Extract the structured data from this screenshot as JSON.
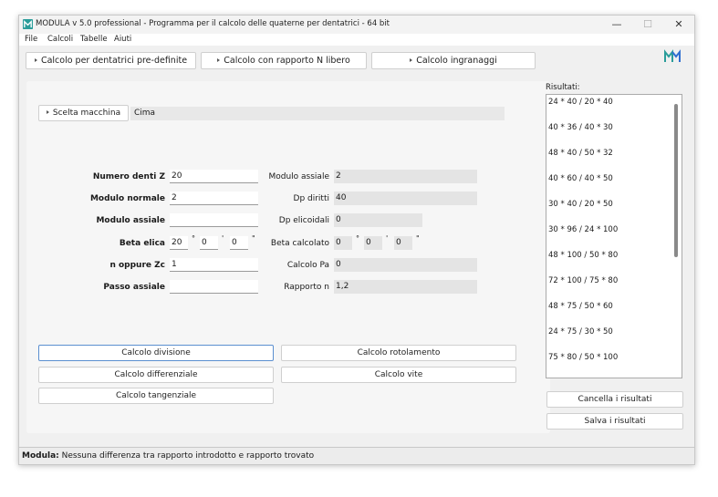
{
  "window": {
    "title": "MODULA v 5.0 professional - Programma per il calcolo delle quaterne per dentatrici - 64 bit",
    "controls": {
      "minimize": "—",
      "maximize": "☐",
      "close": "✕"
    }
  },
  "menu": {
    "items": [
      "File",
      "Calcoli",
      "Tabelle",
      "Aiuti"
    ]
  },
  "top_buttons": {
    "predefined": "Calcolo per dentatrici pre-definite",
    "ratio_free": "Calcolo con rapporto N libero",
    "gears": "Calcolo ingranaggi"
  },
  "machine": {
    "button_label": "Scelta macchina",
    "value": "Cima"
  },
  "left_fields": {
    "numero_denti_z": {
      "label": "Numero denti Z",
      "value": "20"
    },
    "modulo_normale": {
      "label": "Modulo normale",
      "value": "2"
    },
    "modulo_assiale": {
      "label": "Modulo assiale",
      "value": ""
    },
    "beta_elica": {
      "label": "Beta elica",
      "deg": "20",
      "min": "0",
      "sec": "0"
    },
    "n_oppure_zc": {
      "label": "n oppure Zc",
      "value": "1"
    },
    "passo_assiale": {
      "label": "Passo assiale",
      "value": ""
    }
  },
  "right_fields": {
    "modulo_assiale": {
      "label": "Modulo assiale",
      "value": "2"
    },
    "dp_diritti": {
      "label": "Dp diritti",
      "value": "40"
    },
    "dp_elicoidali": {
      "label": "Dp elicoidali",
      "value": "0"
    },
    "beta_calcolato": {
      "label": "Beta calcolato",
      "deg": "0",
      "min": "0",
      "sec": "0"
    },
    "calcolo_pa": {
      "label": "Calcolo Pa",
      "value": "0"
    },
    "rapporto_n": {
      "label": "Rapporto n",
      "value": "1,2"
    }
  },
  "units": {
    "deg": "°",
    "min": "'",
    "sec": "\""
  },
  "calc_buttons": {
    "divisione": "Calcolo divisione",
    "rotolamento": "Calcolo rotolamento",
    "differenziale": "Calcolo differenziale",
    "vite": "Calcolo vite",
    "tangenziale": "Calcolo tangenziale"
  },
  "results": {
    "label": "Risultati:",
    "items": [
      "24 * 40 / 20 * 40",
      "40 * 36 / 40 * 30",
      "48 * 40 / 50 * 32",
      "40 * 60 / 40 * 50",
      "30 * 40 / 20 * 50",
      "30 * 96 / 24 * 100",
      "48 * 100 / 50 * 80",
      "72 * 100 / 75 * 80",
      "48 * 75 / 50 * 60",
      "24 * 75 / 30 * 50",
      "75 * 80 / 50 * 100"
    ],
    "clear_button": "Cancella i risultati",
    "save_button": "Salva i risultati"
  },
  "status": {
    "prefix": "Modula:",
    "message": "Nessuna differenza tra rapporto introdotto e rapporto trovato"
  },
  "colors": {
    "logo_teal": "#2a9d9a",
    "logo_blue": "#2f6fd1",
    "focus_border": "#5b8fd0"
  }
}
